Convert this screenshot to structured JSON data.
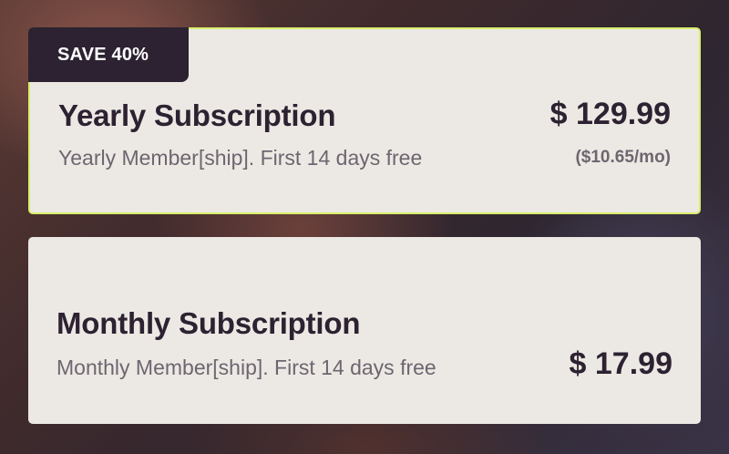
{
  "plans": {
    "yearly": {
      "badge": "SAVE 40%",
      "title": "Yearly Subscription",
      "description": "Yearly Member[ship]. First 14 days free",
      "price": "$ 129.99",
      "per_month": "($10.65/mo)",
      "selected": true
    },
    "monthly": {
      "title": "Monthly Subscription",
      "description": "Monthly Member[ship]. First 14 days free",
      "price": "$ 17.99",
      "selected": false
    }
  },
  "colors": {
    "selected_border": "#d8ef6a",
    "card_background": "#ece9e4",
    "badge_background": "#2c2231",
    "title_text": "#2c2231",
    "secondary_text": "#6d6670"
  }
}
